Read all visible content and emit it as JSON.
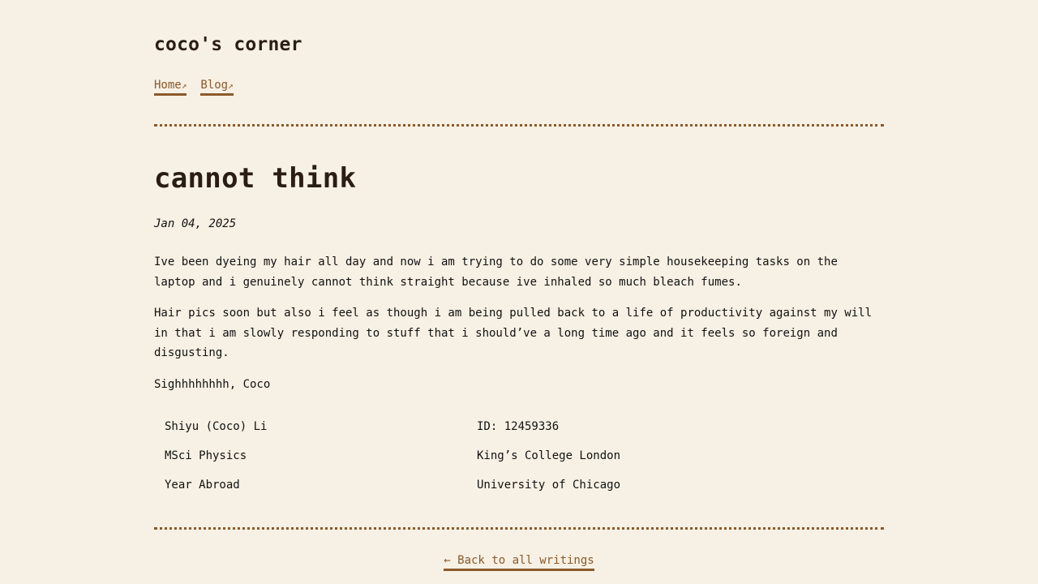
{
  "site": {
    "title": "coco's corner"
  },
  "nav": {
    "items": [
      {
        "label": "Home",
        "arrow": "↗"
      },
      {
        "label": "Blog",
        "arrow": "↗"
      }
    ]
  },
  "post": {
    "title": "cannot think",
    "date": "Jan 04, 2025",
    "paragraphs": [
      "Ive been dyeing my hair all day and now i am trying to do some very simple housekeeping tasks on the laptop and i genuinely cannot think straight because ive inhaled so much bleach fumes.",
      "Hair pics soon but also i feel as though i am being pulled back to a life of productivity against my will in that i am slowly responding to stuff that i should’ve a long time ago and it feels so foreign and disgusting.",
      "Sighhhhhhhh, Coco"
    ]
  },
  "info_table": {
    "rows": [
      [
        "Shiyu (Coco) Li",
        "ID: 12459336"
      ],
      [
        "MSci Physics",
        "King’s College London"
      ],
      [
        "Year Abroad",
        "University of Chicago"
      ]
    ]
  },
  "footer": {
    "back_label": "← Back to all writings"
  },
  "colors": {
    "background": "#f7f0e4",
    "accent": "#8a5a2b",
    "heading": "#2a1d12",
    "text": "#111111"
  }
}
